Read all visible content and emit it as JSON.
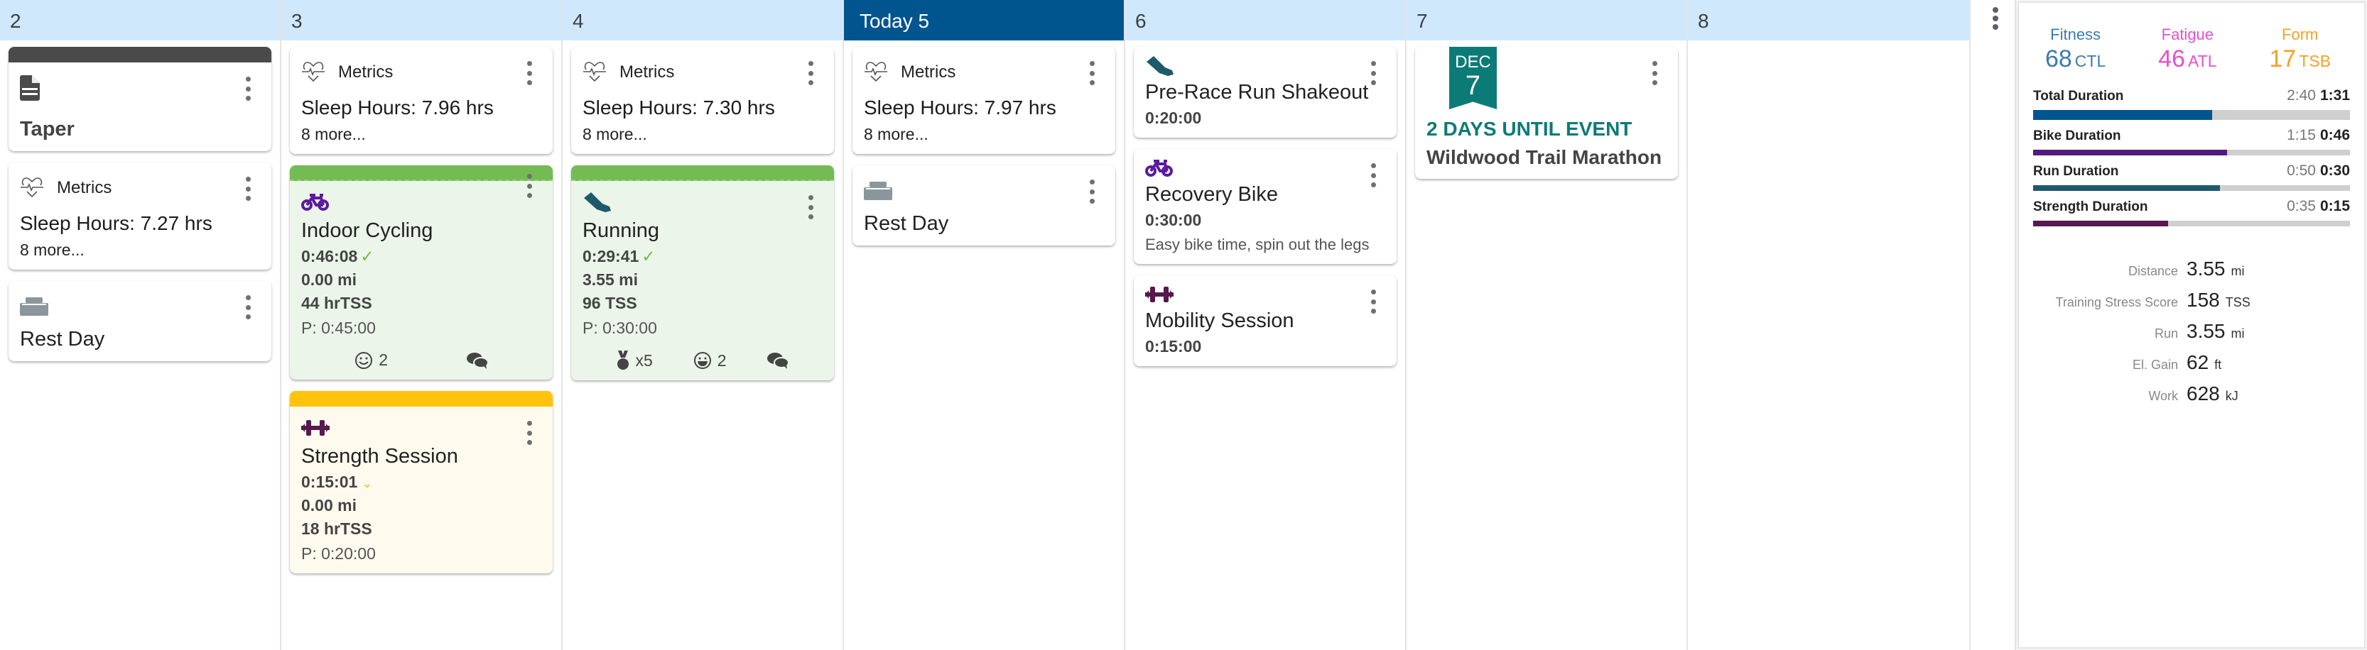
{
  "calendar": {
    "days": [
      {
        "label": "2",
        "today": false
      },
      {
        "label": "3",
        "today": false
      },
      {
        "label": "4",
        "today": false
      },
      {
        "label": "Today 5",
        "today": true
      },
      {
        "label": "6",
        "today": false
      },
      {
        "label": "7",
        "today": false
      },
      {
        "label": "8",
        "today": false
      }
    ],
    "day2": {
      "note": {
        "title": "Taper",
        "icon": "document-icon"
      },
      "metrics": {
        "label": "Metrics",
        "sleep": "Sleep Hours: 7.27 hrs",
        "more": "8 more..."
      },
      "rest": {
        "title": "Rest Day",
        "icon": "bed-icon"
      }
    },
    "day3": {
      "metrics": {
        "label": "Metrics",
        "sleep": "Sleep Hours: 7.96 hrs",
        "more": "8 more..."
      },
      "cycling": {
        "title": "Indoor Cycling",
        "duration": "0:46:08",
        "distance": "0.00 mi",
        "tss": "44 hrTSS",
        "planned": "P: 0:45:00",
        "feel_count": "2",
        "status_color": "#74bb55"
      },
      "strength": {
        "title": "Strength Session",
        "duration": "0:15:01",
        "distance": "0.00 mi",
        "tss": "18 hrTSS",
        "planned": "P: 0:20:00",
        "status_color": "#fec30a"
      }
    },
    "day4": {
      "metrics": {
        "label": "Metrics",
        "sleep": "Sleep Hours: 7.30 hrs",
        "more": "8 more..."
      },
      "running": {
        "title": "Running",
        "duration": "0:29:41",
        "distance": "3.55 mi",
        "tss": "96 TSS",
        "planned": "P: 0:30:00",
        "medals": "x5",
        "feel_count": "2",
        "status_color": "#74bb55"
      }
    },
    "day5": {
      "metrics": {
        "label": "Metrics",
        "sleep": "Sleep Hours: 7.97 hrs",
        "more": "8 more..."
      },
      "rest": {
        "title": "Rest Day"
      }
    },
    "day6": {
      "shakeout": {
        "title": "Pre-Race Run Shakeout",
        "duration": "0:20:00"
      },
      "recovery": {
        "title": "Recovery Bike",
        "duration": "0:30:00",
        "description": "Easy bike time, spin out the legs"
      },
      "mobility": {
        "title": "Mobility Session",
        "duration": "0:15:00"
      }
    },
    "day7": {
      "event": {
        "month": "DEC",
        "day": "7",
        "countdown": "2 DAYS UNTIL EVENT",
        "title": "Wildwood Trail Marathon"
      }
    }
  },
  "summary": {
    "fitness": {
      "label": "Fitness",
      "value": "68",
      "unit": "CTL",
      "color": "#3d7ab0"
    },
    "fatigue": {
      "label": "Fatigue",
      "value": "46",
      "unit": "ATL",
      "color": "#e84fcb"
    },
    "form": {
      "label": "Form",
      "value": "17",
      "unit": "TSB",
      "color": "#f4a125"
    },
    "durations": [
      {
        "name": "Total Duration",
        "planned": "2:40",
        "actual": "1:31",
        "fraction": 0.565,
        "color": "#00558f"
      },
      {
        "name": "Bike Duration",
        "planned": "1:15",
        "actual": "0:46",
        "fraction": 0.613,
        "color": "#511a7d"
      },
      {
        "name": "Run Duration",
        "planned": "0:50",
        "actual": "0:30",
        "fraction": 0.59,
        "color": "#1d5a6b"
      },
      {
        "name": "Strength Duration",
        "planned": "0:35",
        "actual": "0:15",
        "fraction": 0.427,
        "color": "#561a4f"
      }
    ],
    "totals": [
      {
        "label": "Distance",
        "value": "3.55",
        "unit": "mi"
      },
      {
        "label": "Training Stress Score",
        "value": "158",
        "unit": "TSS"
      },
      {
        "label": "Run",
        "value": "3.55",
        "unit": "mi"
      },
      {
        "label": "El. Gain",
        "value": "62",
        "unit": "ft"
      },
      {
        "label": "Work",
        "value": "628",
        "unit": "kJ"
      }
    ]
  },
  "colors": {
    "header_bg": "#d0e8fb",
    "today_bg": "#00558f",
    "bike": "#5b1a9e",
    "run": "#1d5a6b",
    "strength": "#561a4f",
    "event": "#0c7b78",
    "rest": "#8a969c"
  }
}
